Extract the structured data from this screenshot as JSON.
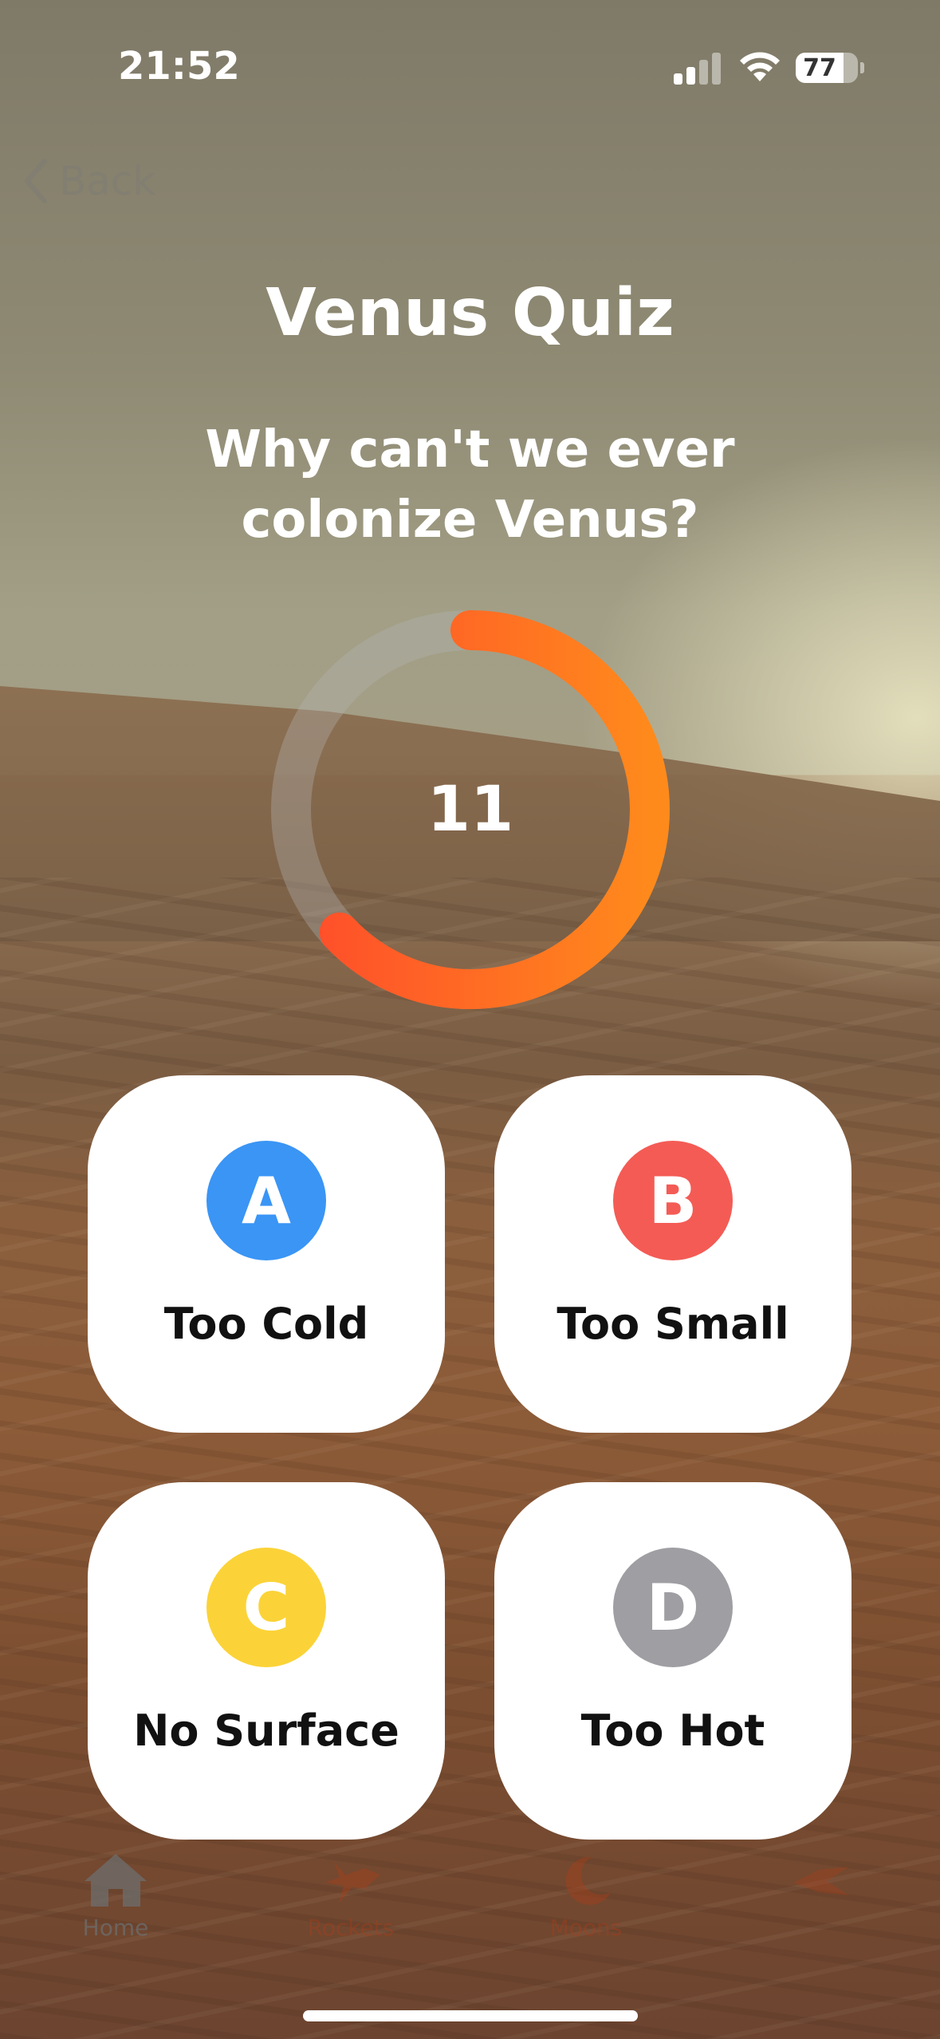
{
  "status_bar": {
    "time": "21:52",
    "battery": "77"
  },
  "nav": {
    "back_label": "Back"
  },
  "quiz": {
    "title": "Venus Quiz",
    "question": "Why can't we ever colonize Venus?",
    "timer_value": "11",
    "timer_progress": 0.63
  },
  "answers": [
    {
      "letter": "A",
      "text": "Too Cold",
      "color": "#3a95f5"
    },
    {
      "letter": "B",
      "text": "Too Small",
      "color": "#f45b55"
    },
    {
      "letter": "C",
      "text": "No Surface",
      "color": "#fbd338"
    },
    {
      "letter": "D",
      "text": "Too Hot",
      "color": "#9e9ea3"
    }
  ],
  "tab_bar": {
    "items": [
      {
        "label": "Home",
        "icon": "house-icon",
        "active": true
      },
      {
        "label": "Rockets",
        "icon": "rocket-icon",
        "active": false
      },
      {
        "label": "Moons",
        "icon": "moon-icon",
        "active": false
      },
      {
        "label": "",
        "icon": "more-icon",
        "active": false
      }
    ]
  },
  "colors": {
    "timer_start": "#ff4b2b",
    "timer_end": "#ff8a1c"
  }
}
